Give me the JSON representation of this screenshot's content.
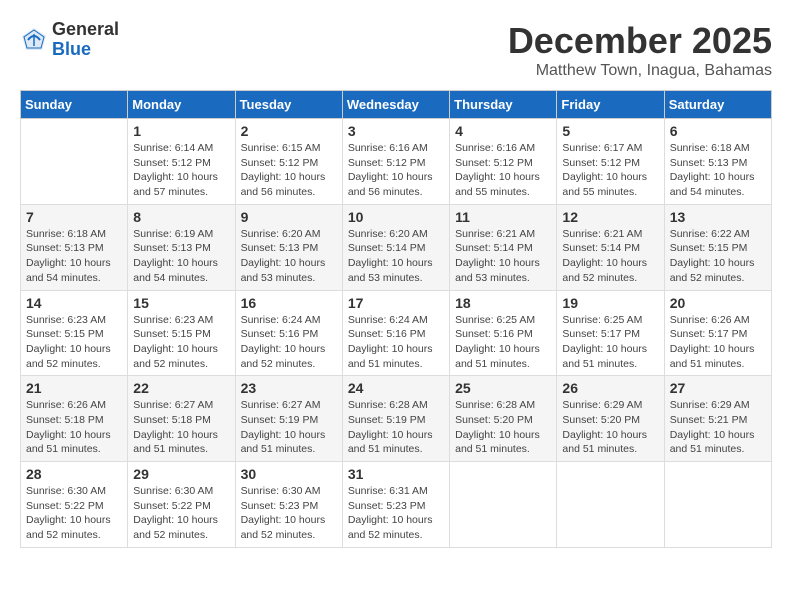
{
  "logo": {
    "general": "General",
    "blue": "Blue"
  },
  "title": "December 2025",
  "location": "Matthew Town, Inagua, Bahamas",
  "days_header": [
    "Sunday",
    "Monday",
    "Tuesday",
    "Wednesday",
    "Thursday",
    "Friday",
    "Saturday"
  ],
  "weeks": [
    [
      {
        "day": "",
        "info": ""
      },
      {
        "day": "1",
        "info": "Sunrise: 6:14 AM\nSunset: 5:12 PM\nDaylight: 10 hours\nand 57 minutes."
      },
      {
        "day": "2",
        "info": "Sunrise: 6:15 AM\nSunset: 5:12 PM\nDaylight: 10 hours\nand 56 minutes."
      },
      {
        "day": "3",
        "info": "Sunrise: 6:16 AM\nSunset: 5:12 PM\nDaylight: 10 hours\nand 56 minutes."
      },
      {
        "day": "4",
        "info": "Sunrise: 6:16 AM\nSunset: 5:12 PM\nDaylight: 10 hours\nand 55 minutes."
      },
      {
        "day": "5",
        "info": "Sunrise: 6:17 AM\nSunset: 5:12 PM\nDaylight: 10 hours\nand 55 minutes."
      },
      {
        "day": "6",
        "info": "Sunrise: 6:18 AM\nSunset: 5:13 PM\nDaylight: 10 hours\nand 54 minutes."
      }
    ],
    [
      {
        "day": "7",
        "info": "Sunrise: 6:18 AM\nSunset: 5:13 PM\nDaylight: 10 hours\nand 54 minutes."
      },
      {
        "day": "8",
        "info": "Sunrise: 6:19 AM\nSunset: 5:13 PM\nDaylight: 10 hours\nand 54 minutes."
      },
      {
        "day": "9",
        "info": "Sunrise: 6:20 AM\nSunset: 5:13 PM\nDaylight: 10 hours\nand 53 minutes."
      },
      {
        "day": "10",
        "info": "Sunrise: 6:20 AM\nSunset: 5:14 PM\nDaylight: 10 hours\nand 53 minutes."
      },
      {
        "day": "11",
        "info": "Sunrise: 6:21 AM\nSunset: 5:14 PM\nDaylight: 10 hours\nand 53 minutes."
      },
      {
        "day": "12",
        "info": "Sunrise: 6:21 AM\nSunset: 5:14 PM\nDaylight: 10 hours\nand 52 minutes."
      },
      {
        "day": "13",
        "info": "Sunrise: 6:22 AM\nSunset: 5:15 PM\nDaylight: 10 hours\nand 52 minutes."
      }
    ],
    [
      {
        "day": "14",
        "info": "Sunrise: 6:23 AM\nSunset: 5:15 PM\nDaylight: 10 hours\nand 52 minutes."
      },
      {
        "day": "15",
        "info": "Sunrise: 6:23 AM\nSunset: 5:15 PM\nDaylight: 10 hours\nand 52 minutes."
      },
      {
        "day": "16",
        "info": "Sunrise: 6:24 AM\nSunset: 5:16 PM\nDaylight: 10 hours\nand 52 minutes."
      },
      {
        "day": "17",
        "info": "Sunrise: 6:24 AM\nSunset: 5:16 PM\nDaylight: 10 hours\nand 51 minutes."
      },
      {
        "day": "18",
        "info": "Sunrise: 6:25 AM\nSunset: 5:16 PM\nDaylight: 10 hours\nand 51 minutes."
      },
      {
        "day": "19",
        "info": "Sunrise: 6:25 AM\nSunset: 5:17 PM\nDaylight: 10 hours\nand 51 minutes."
      },
      {
        "day": "20",
        "info": "Sunrise: 6:26 AM\nSunset: 5:17 PM\nDaylight: 10 hours\nand 51 minutes."
      }
    ],
    [
      {
        "day": "21",
        "info": "Sunrise: 6:26 AM\nSunset: 5:18 PM\nDaylight: 10 hours\nand 51 minutes."
      },
      {
        "day": "22",
        "info": "Sunrise: 6:27 AM\nSunset: 5:18 PM\nDaylight: 10 hours\nand 51 minutes."
      },
      {
        "day": "23",
        "info": "Sunrise: 6:27 AM\nSunset: 5:19 PM\nDaylight: 10 hours\nand 51 minutes."
      },
      {
        "day": "24",
        "info": "Sunrise: 6:28 AM\nSunset: 5:19 PM\nDaylight: 10 hours\nand 51 minutes."
      },
      {
        "day": "25",
        "info": "Sunrise: 6:28 AM\nSunset: 5:20 PM\nDaylight: 10 hours\nand 51 minutes."
      },
      {
        "day": "26",
        "info": "Sunrise: 6:29 AM\nSunset: 5:20 PM\nDaylight: 10 hours\nand 51 minutes."
      },
      {
        "day": "27",
        "info": "Sunrise: 6:29 AM\nSunset: 5:21 PM\nDaylight: 10 hours\nand 51 minutes."
      }
    ],
    [
      {
        "day": "28",
        "info": "Sunrise: 6:30 AM\nSunset: 5:22 PM\nDaylight: 10 hours\nand 52 minutes."
      },
      {
        "day": "29",
        "info": "Sunrise: 6:30 AM\nSunset: 5:22 PM\nDaylight: 10 hours\nand 52 minutes."
      },
      {
        "day": "30",
        "info": "Sunrise: 6:30 AM\nSunset: 5:23 PM\nDaylight: 10 hours\nand 52 minutes."
      },
      {
        "day": "31",
        "info": "Sunrise: 6:31 AM\nSunset: 5:23 PM\nDaylight: 10 hours\nand 52 minutes."
      },
      {
        "day": "",
        "info": ""
      },
      {
        "day": "",
        "info": ""
      },
      {
        "day": "",
        "info": ""
      }
    ]
  ]
}
